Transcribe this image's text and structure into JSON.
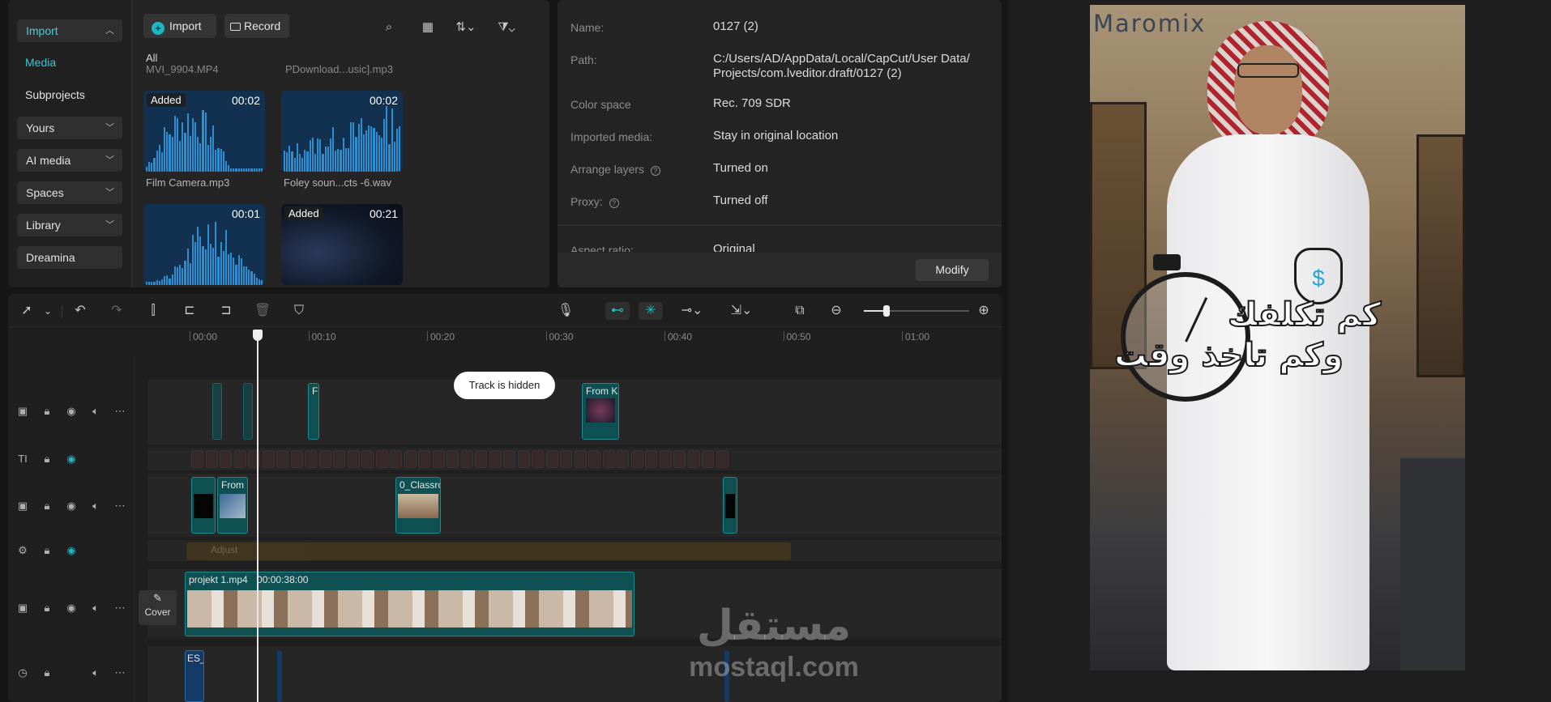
{
  "sidebar": {
    "import_label": "Import",
    "media_label": "Media",
    "subprojects_label": "Subprojects",
    "yours_label": "Yours",
    "ai_media_label": "AI media",
    "spaces_label": "Spaces",
    "library_label": "Library",
    "dreamina_label": "Dreamina"
  },
  "media_toolbar": {
    "import_label": "Import",
    "record_label": "Record",
    "filter_all": "All"
  },
  "media_items": [
    {
      "name": "MVI_9904.MP4",
      "duration": "",
      "added": false
    },
    {
      "name": "PDownload...usic].mp3",
      "duration": "",
      "added": false
    },
    {
      "name": "Film Camera.mp3",
      "duration": "00:02",
      "added": true
    },
    {
      "name": "Foley soun...cts -6.wav",
      "duration": "00:02",
      "added": false
    },
    {
      "name": "",
      "duration": "00:01",
      "added": false
    },
    {
      "name": "",
      "duration": "00:21",
      "added": true
    }
  ],
  "added_badge": "Added",
  "project_info": {
    "name_label": "Name:",
    "name_value": "0127 (2)",
    "path_label": "Path:",
    "path_value": "C:/Users/AD/AppData/Local/CapCut/User Data/ Projects/com.lveditor.draft/0127 (2)",
    "color_space_label": "Color space",
    "color_space_value": "Rec. 709 SDR",
    "imported_media_label": "Imported media:",
    "imported_media_value": "Stay in original location",
    "arrange_layers_label": "Arrange layers",
    "arrange_layers_value": "Turned on",
    "proxy_label": "Proxy:",
    "proxy_value": "Turned off",
    "aspect_ratio_label": "Aspect ratio:",
    "aspect_ratio_value": "Original",
    "modify_label": "Modify"
  },
  "timeline": {
    "ruler": [
      "00:00",
      "00:10",
      "00:20",
      "00:30",
      "00:40",
      "00:50",
      "01:00"
    ],
    "track_hidden_tooltip": "Track is hidden",
    "clips": {
      "from_k": "From K",
      "from": "From",
      "classroom": "0_Classro",
      "f_short": "F",
      "main_name": "projekt 1.mp4",
      "main_duration": "00:00:38:00",
      "audio_name": "ES_",
      "adjust_name": "Adjust"
    },
    "cover_label": "Cover"
  },
  "preview": {
    "brand_text": "Maromix",
    "overlay_line1": "كم تكلفك",
    "overlay_line2": "وكم تاخذ وقت"
  },
  "watermark": {
    "arabic": "مستقل",
    "latin": "mostaql.com"
  },
  "colors": {
    "accent_teal": "#1fb6c1",
    "clip_teal": "#0e4f52",
    "import_highlight": "#2f2f30"
  }
}
